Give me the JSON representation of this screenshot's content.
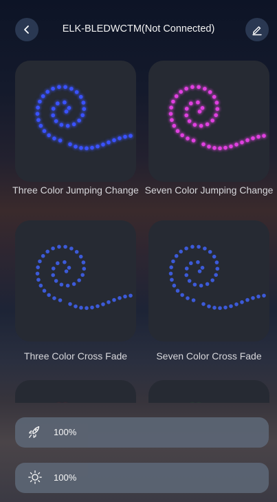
{
  "header": {
    "title": "ELK-BLEDWCTM(Not Connected)",
    "back_icon": "chevron-left-icon",
    "edit_icon": "pencil-icon"
  },
  "modes": [
    {
      "label": "Three Color Jumping Change",
      "dot_color": "#3a52ff",
      "glow": true
    },
    {
      "label": "Seven Color Jumping Change",
      "dot_color": "#e040e0",
      "glow": true
    },
    {
      "label": "Three Color Cross Fade",
      "dot_color": "#3c5ad8",
      "glow": false
    },
    {
      "label": "Seven Color Cross Fade",
      "dot_color": "#3c5ad8",
      "glow": false
    },
    {
      "label": "",
      "dot_color": "#ff2a2a",
      "glow": true
    },
    {
      "label": "",
      "dot_color": "#40d040",
      "glow": true
    }
  ],
  "speed": {
    "icon": "rocket-icon",
    "value": "100%"
  },
  "brightness": {
    "icon": "sun-icon",
    "value": "100%"
  }
}
